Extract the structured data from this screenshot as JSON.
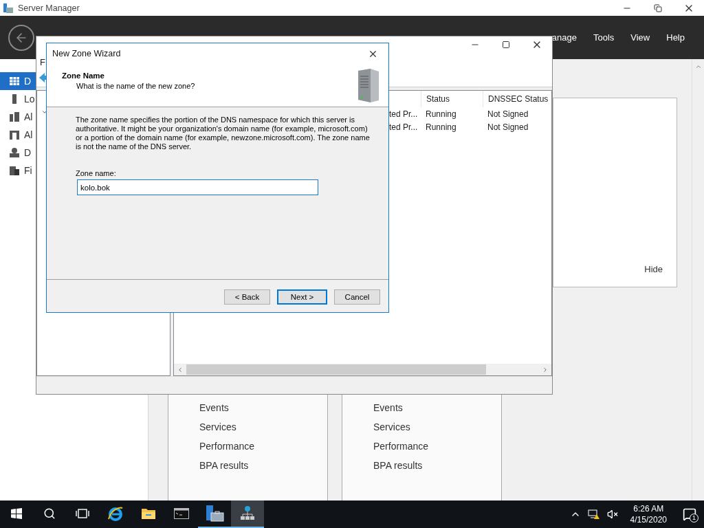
{
  "server_manager": {
    "title": "Server Manager",
    "menu": [
      "anage",
      "Tools",
      "View",
      "Help"
    ],
    "sidebar": [
      {
        "label": "D",
        "kind": "dashboard",
        "selected": true
      },
      {
        "label": "Lo",
        "kind": "server",
        "selected": false
      },
      {
        "label": "Al",
        "kind": "servers",
        "selected": false
      },
      {
        "label": "Al",
        "kind": "group",
        "selected": false
      },
      {
        "label": "D",
        "kind": "dns",
        "selected": false
      },
      {
        "label": "Fi",
        "kind": "files",
        "selected": false
      }
    ],
    "welcome_panel": {
      "hide_link": "Hide"
    },
    "tiles": [
      {
        "links": [
          "Events",
          "Services",
          "Performance",
          "BPA results"
        ]
      },
      {
        "links": [
          "Events",
          "Services",
          "Performance",
          "BPA results"
        ]
      }
    ]
  },
  "dns_manager": {
    "menu": [
      "F"
    ],
    "table": {
      "columns": [
        "Status",
        "DNSSEC Status"
      ],
      "rows": [
        {
          "column_1": "ted Pr...",
          "status": "Running",
          "dnssec_status": "Not Signed"
        },
        {
          "column_1": "ted Pr...",
          "status": "Running",
          "dnssec_status": "Not Signed"
        }
      ]
    }
  },
  "wizard": {
    "title": "New Zone Wizard",
    "heading": "Zone Name",
    "subheading": "What is the name of the new zone?",
    "description": "The zone name specifies the portion of the DNS namespace for which this server is authoritative. It might be your organization's domain name (for example,  microsoft.com) or a portion of the domain name (for example, newzone.microsoft.com). The zone name is not the name of the DNS server.",
    "field": {
      "label": "Zone name:",
      "value": "kolo.bok"
    },
    "buttons": [
      {
        "label": "< Back",
        "default": false
      },
      {
        "label": "Next >",
        "default": true
      },
      {
        "label": "Cancel",
        "default": false
      }
    ]
  },
  "taskbar": {
    "apps": [
      {
        "kind": "start",
        "running": false,
        "selected": false
      },
      {
        "kind": "search",
        "running": false,
        "selected": false
      },
      {
        "kind": "task_view",
        "running": false,
        "selected": false
      },
      {
        "kind": "ie",
        "running": false,
        "selected": false
      },
      {
        "kind": "explorer",
        "running": false,
        "selected": false
      },
      {
        "kind": "cmd",
        "running": false,
        "selected": false
      },
      {
        "kind": "server_manager",
        "running": true,
        "selected": false
      },
      {
        "kind": "dns",
        "running": true,
        "selected": true
      }
    ],
    "time": "6:26 AM",
    "date": "4/15/2020",
    "notifications": "1"
  }
}
